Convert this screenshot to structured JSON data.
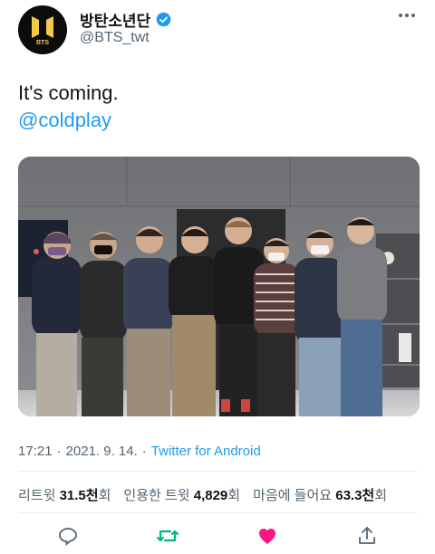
{
  "tweet": {
    "display_name": "방탄소년단",
    "handle": "@BTS_twt",
    "avatar_icon": "bts-logo-icon",
    "text": "It's coming.",
    "mention": "@coldplay",
    "time": "17:21",
    "dot1": "·",
    "date": "2021. 9. 14.",
    "dot2": "·",
    "source": "Twitter for Android"
  },
  "stats": {
    "retweets_label": "리트윗",
    "retweets_value": "31.5천",
    "retweets_unit": "회",
    "quotes_label": "인용한 트윗",
    "quotes_value": "4,829",
    "quotes_unit": "회",
    "likes_label": "마음에 들어요",
    "likes_value": "63.3천",
    "likes_unit": "회"
  },
  "actions": [
    "reply-icon",
    "retweet-icon",
    "like-icon",
    "share-icon"
  ],
  "colors": {
    "link": "#1d9bf0",
    "retweet_active": "#00ba7c",
    "like_active": "#f91880",
    "secondary_text": "#536471"
  }
}
